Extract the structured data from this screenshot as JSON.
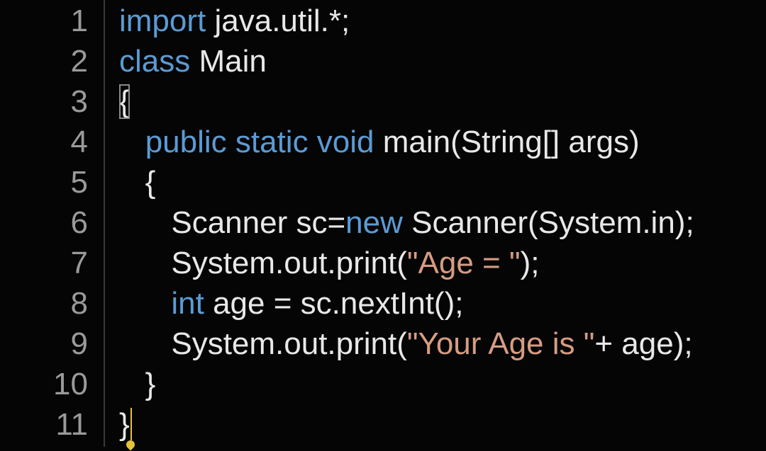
{
  "editor": {
    "lines": [
      {
        "number": "1",
        "tokens": [
          {
            "t": "import",
            "k": "kw"
          },
          {
            "t": " java.util.*;",
            "k": "plain"
          }
        ]
      },
      {
        "number": "2",
        "tokens": [
          {
            "t": "class",
            "k": "kw"
          },
          {
            "t": " Main",
            "k": "plain"
          }
        ]
      },
      {
        "number": "3",
        "tokens": [
          {
            "t": "{",
            "k": "plain",
            "boxed": true
          }
        ]
      },
      {
        "number": "4",
        "tokens": [
          {
            "t": "   ",
            "k": "plain"
          },
          {
            "t": "public static void",
            "k": "kw"
          },
          {
            "t": " main(String[] args)",
            "k": "plain"
          }
        ]
      },
      {
        "number": "5",
        "tokens": [
          {
            "t": "   {",
            "k": "plain"
          }
        ]
      },
      {
        "number": "6",
        "tokens": [
          {
            "t": "      Scanner sc=",
            "k": "plain"
          },
          {
            "t": "new",
            "k": "kw"
          },
          {
            "t": " Scanner(System.in);",
            "k": "plain"
          }
        ]
      },
      {
        "number": "7",
        "tokens": [
          {
            "t": "      System.out.print(",
            "k": "plain"
          },
          {
            "t": "\"Age = \"",
            "k": "str"
          },
          {
            "t": ");",
            "k": "plain"
          }
        ]
      },
      {
        "number": "8",
        "tokens": [
          {
            "t": "      ",
            "k": "plain"
          },
          {
            "t": "int",
            "k": "kw"
          },
          {
            "t": " age = sc.nextInt();",
            "k": "plain"
          }
        ]
      },
      {
        "number": "9",
        "tokens": [
          {
            "t": "      System.out.print(",
            "k": "plain"
          },
          {
            "t": "\"Your Age is \"",
            "k": "str"
          },
          {
            "t": "+ age);",
            "k": "plain"
          }
        ]
      },
      {
        "number": "10",
        "tokens": [
          {
            "t": "   }",
            "k": "plain"
          }
        ]
      },
      {
        "number": "11",
        "tokens": [
          {
            "t": "}",
            "k": "plain"
          }
        ],
        "cursor": true
      }
    ]
  },
  "colors": {
    "background": "#050505",
    "keyword": "#5a9bd5",
    "plain": "#e8e8e8",
    "string": "#d79c82",
    "line_number": "#9a9a9a",
    "cursor": "#e6c23a"
  }
}
